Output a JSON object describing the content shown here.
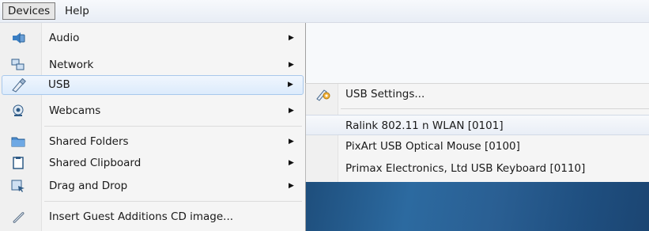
{
  "menubar": {
    "items": [
      {
        "label": "Devices"
      },
      {
        "label": "Help"
      }
    ]
  },
  "menu": {
    "items": [
      {
        "label": "Audio",
        "icon": "audio-icon",
        "has_submenu": true
      },
      {
        "label": "Network",
        "icon": "network-icon",
        "has_submenu": true
      },
      {
        "label": "USB",
        "icon": "usb-icon",
        "has_submenu": true
      },
      {
        "label": "Webcams",
        "icon": "webcam-icon",
        "has_submenu": true
      },
      {
        "label": "Shared Folders",
        "icon": "folder-icon",
        "has_submenu": true
      },
      {
        "label": "Shared Clipboard",
        "icon": "clipboard-icon",
        "has_submenu": true
      },
      {
        "label": "Drag and Drop",
        "icon": "drag-drop-icon",
        "has_submenu": true
      },
      {
        "label": "Insert Guest Additions CD image...",
        "icon": "cd-icon",
        "has_submenu": false
      }
    ],
    "arrow": "▶"
  },
  "usb_submenu": {
    "settings_label": "USB Settings...",
    "devices": [
      {
        "label": "Ralink 802.11 n WLAN [0101]"
      },
      {
        "label": "PixArt USB Optical Mouse [0100]"
      },
      {
        "label": "Primax Electronics, Ltd USB Keyboard [0110]"
      }
    ]
  },
  "colors": {
    "highlight": "#dcebfc",
    "desktop": "#2a5f93"
  }
}
